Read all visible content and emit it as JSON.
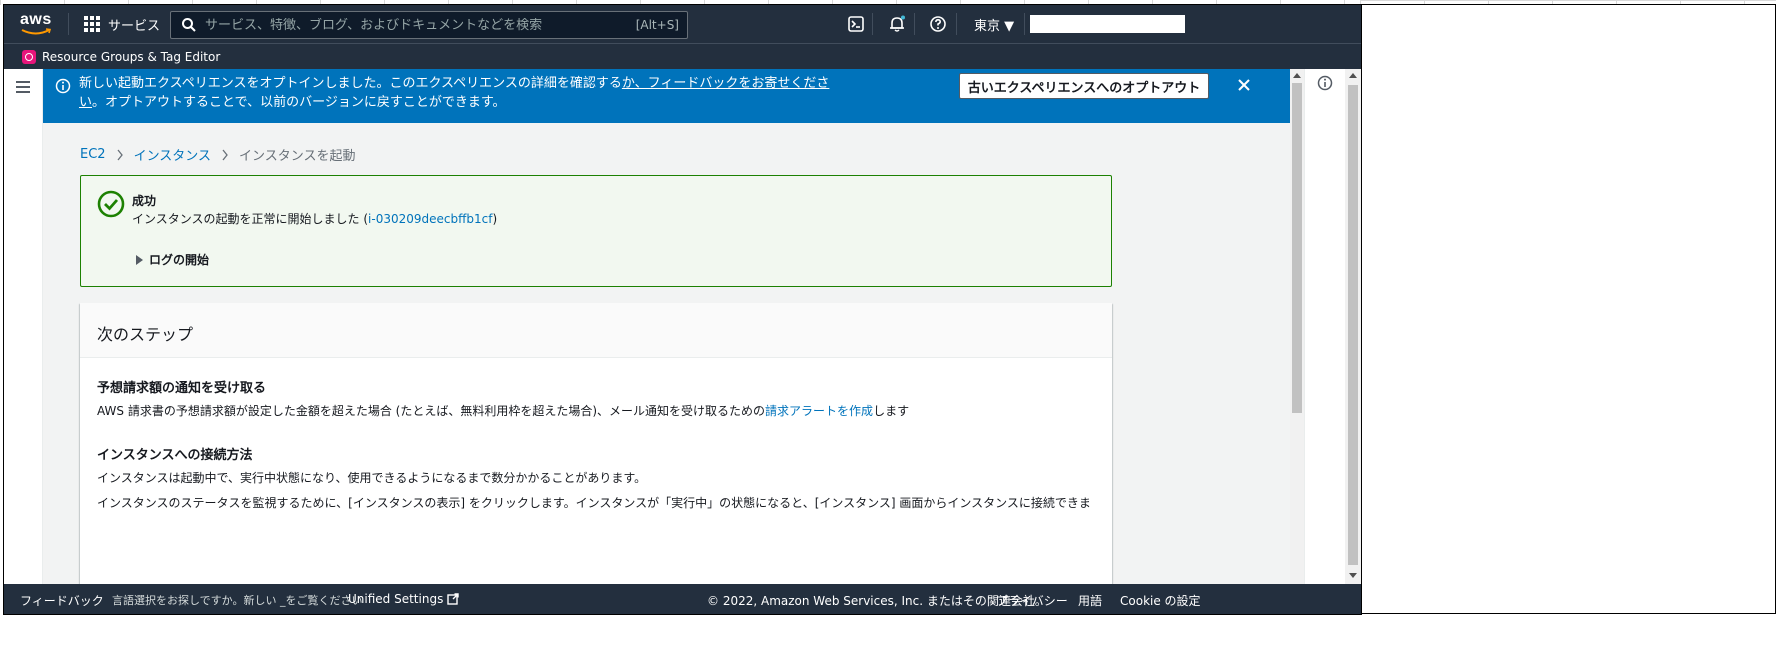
{
  "topnav": {
    "logo_text": "aws",
    "services_label": "サービス",
    "search_placeholder": "サービス、特徴、ブログ、およびドキュメントなどを検索",
    "search_shortcut": "[Alt+S]",
    "region_label": "東京 ▼"
  },
  "subnav": {
    "resource_groups_label": "Resource Groups & Tag Editor"
  },
  "banner": {
    "text_before": "新しい起動エクスペリエンスをオプトインしました。このエクスペリエンスの詳細を確認する",
    "feedback_link": "か、フィードバックをお寄せください",
    "text_after": "。オプトアウトすることで、以前のバージョンに戻すことができます。",
    "optout_button": "古いエクスペリエンスへのオプトアウト"
  },
  "breadcrumb": {
    "items": [
      "EC2",
      "インスタンス",
      "インスタンスを起動"
    ]
  },
  "success": {
    "title": "成功",
    "message_before": "インスタンスの起動を正常に開始しました (",
    "instance_id": "i-030209deecbffb1cf",
    "message_after": ")",
    "log_toggle": "ログの開始"
  },
  "next_steps": {
    "title": "次のステップ",
    "section1_title": "予想請求額の通知を受け取る",
    "section1_text_before": "AWS 請求書の予想請求額が設定した金額を超えた場合 (たとえば、無料利用枠を超えた場合)、メール通知を受け取るための",
    "section1_link": "請求アラートを作成",
    "section1_text_after": "します",
    "section2_title": "インスタンスへの接続方法",
    "section2_line1": "インスタンスは起動中で、実行中状態になり、使用できるようになるまで数分かかることがあります。",
    "section2_line2": "インスタンスのステータスを監視するために、[インスタンスの表示] をクリックします。インスタンスが「実行中」の状態になると、[インスタンス] 画面からインスタンスに接続できま"
  },
  "footer": {
    "feedback": "フィードバック",
    "language_prompt": "言語選択をお探しですか。新しい _をご覧ください",
    "unified_settings": "Unified Settings",
    "copyright": "© 2022, Amazon Web Services, Inc. またはその関連会社。",
    "privacy": "プライバシー",
    "terms": "用語",
    "cookie": "Cookie の設定"
  },
  "colors": {
    "nav_bg": "#232f3e",
    "banner_bg": "#0073bb",
    "link": "#0073bb",
    "success_border": "#1d8102",
    "success_bg": "#f2f8f0"
  }
}
